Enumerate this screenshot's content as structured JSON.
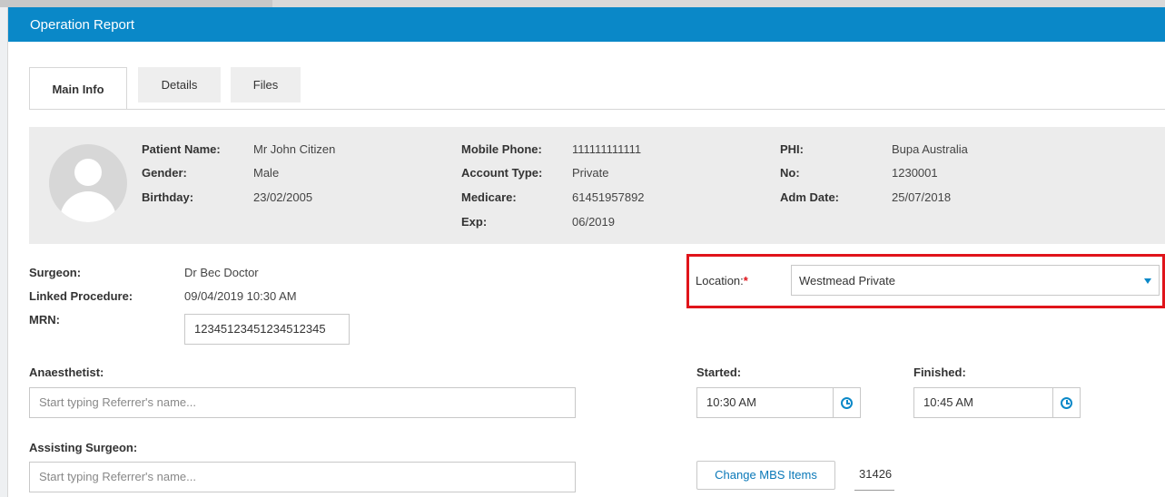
{
  "window": {
    "title": "Operation Report"
  },
  "tabs": [
    {
      "label": "Main Info",
      "active": true
    },
    {
      "label": "Details",
      "active": false
    },
    {
      "label": "Files",
      "active": false
    }
  ],
  "patient": {
    "name_label": "Patient Name:",
    "name": "Mr John Citizen",
    "gender_label": "Gender:",
    "gender": "Male",
    "birthday_label": "Birthday:",
    "birthday": "23/02/2005",
    "mobile_label": "Mobile Phone:",
    "mobile": "111111111111",
    "account_label": "Account Type:",
    "account": "Private",
    "medicare_label": "Medicare:",
    "medicare": "61451957892",
    "exp_label": "Exp:",
    "exp": "06/2019",
    "phi_label": "PHI:",
    "phi": "Bupa Australia",
    "no_label": "No:",
    "no": "1230001",
    "adm_label": "Adm Date:",
    "adm": "25/07/2018"
  },
  "form": {
    "surgeon_label": "Surgeon:",
    "surgeon": "Dr Bec Doctor",
    "linked_label": "Linked Procedure:",
    "linked": "09/04/2019 10:30 AM",
    "mrn_label": "MRN:",
    "mrn": "12345123451234512345",
    "location_label": "Location:",
    "location_required": "*",
    "location": "Westmead Private",
    "anaesthetist_label": "Anaesthetist:",
    "anaesthetist_placeholder": "Start typing Referrer's name...",
    "started_label": "Started:",
    "started": "10:30 AM",
    "finished_label": "Finished:",
    "finished": "10:45 AM",
    "assisting_label": "Assisting Surgeon:",
    "assisting_placeholder": "Start typing Referrer's name...",
    "change_mbs_label": "Change MBS Items",
    "mbs_item": "31426"
  },
  "colors": {
    "accent": "#0a88c8",
    "highlight": "#e0141a",
    "panel": "#ececec"
  },
  "icons": {
    "avatar": "user-avatar-icon",
    "clock": "clock-icon",
    "dropdown": "caret-down-icon"
  }
}
